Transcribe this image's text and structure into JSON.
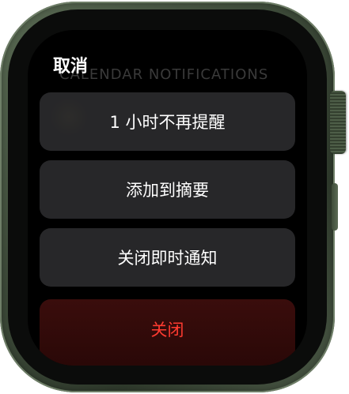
{
  "screen": {
    "background_heading": "CALENDAR NOTIFICATIONS",
    "cancel_label": "取消",
    "options": [
      {
        "label": "1 小时不再提醒"
      },
      {
        "label": "添加到摘要"
      },
      {
        "label": "关闭即时通知"
      }
    ],
    "close_label": "关闭"
  },
  "colors": {
    "case": "#3d4a39",
    "screen": "#000000",
    "option_bg": "#2a2a2c",
    "destructive_text": "#ff3b30",
    "destructive_bg": "#2a0807"
  }
}
